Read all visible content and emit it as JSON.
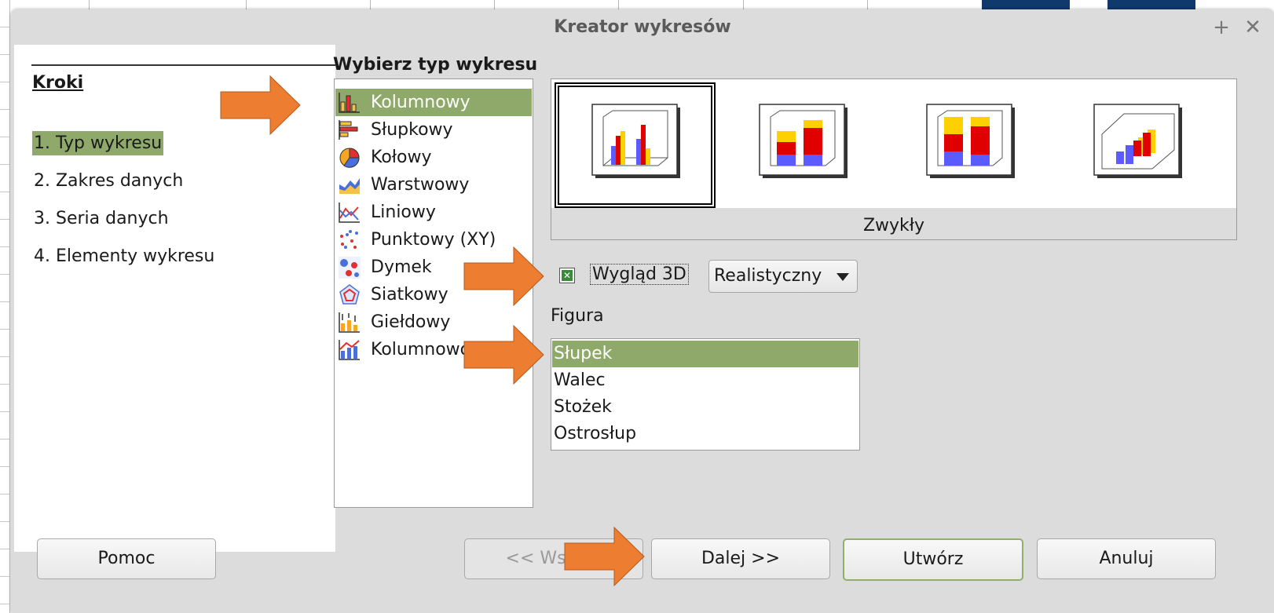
{
  "dialog": {
    "title": "Kreator wykresów",
    "maximize_glyph": "+",
    "close_glyph": "✕"
  },
  "steps": {
    "title": "Kroki",
    "items": [
      {
        "label": "1. Typ wykresu",
        "active": true
      },
      {
        "label": "2. Zakres danych",
        "active": false
      },
      {
        "label": "3. Seria danych",
        "active": false
      },
      {
        "label": "4. Elementy wykresu",
        "active": false
      }
    ]
  },
  "chart_type": {
    "heading": "Wybierz typ wykresu",
    "items": [
      {
        "label": "Kolumnowy",
        "icon": "column-chart-icon",
        "selected": true
      },
      {
        "label": "Słupkowy",
        "icon": "bar-chart-icon"
      },
      {
        "label": "Kołowy",
        "icon": "pie-chart-icon"
      },
      {
        "label": "Warstwowy",
        "icon": "area-chart-icon"
      },
      {
        "label": "Liniowy",
        "icon": "line-chart-icon"
      },
      {
        "label": "Punktowy (XY)",
        "icon": "scatter-chart-icon"
      },
      {
        "label": "Dymek",
        "icon": "bubble-chart-icon"
      },
      {
        "label": "Siatkowy",
        "icon": "net-chart-icon"
      },
      {
        "label": "Giełdowy",
        "icon": "stock-chart-icon"
      },
      {
        "label": "Kolumnowo",
        "icon": "column-line-chart-icon"
      }
    ]
  },
  "variants": {
    "caption": "Zwykły",
    "items": [
      {
        "name": "normal",
        "selected": true
      },
      {
        "name": "stacked"
      },
      {
        "name": "percent-stacked"
      },
      {
        "name": "deep"
      }
    ]
  },
  "look3d": {
    "checkbox_label": "Wygląd 3D",
    "checked": true,
    "scheme_value": "Realistyczny"
  },
  "shape": {
    "label": "Figura",
    "items": [
      {
        "label": "Słupek",
        "selected": true
      },
      {
        "label": "Walec"
      },
      {
        "label": "Stożek"
      },
      {
        "label": "Ostrosłup"
      }
    ]
  },
  "buttons": {
    "help": "Pomoc",
    "back": "<< Wstecz",
    "next": "Dalej >>",
    "finish": "Utwórz",
    "cancel": "Anuluj"
  },
  "colors": {
    "selection": "#8fa96a",
    "arrow": "#ed7d31",
    "dialog_bg": "#dcdcdc"
  }
}
